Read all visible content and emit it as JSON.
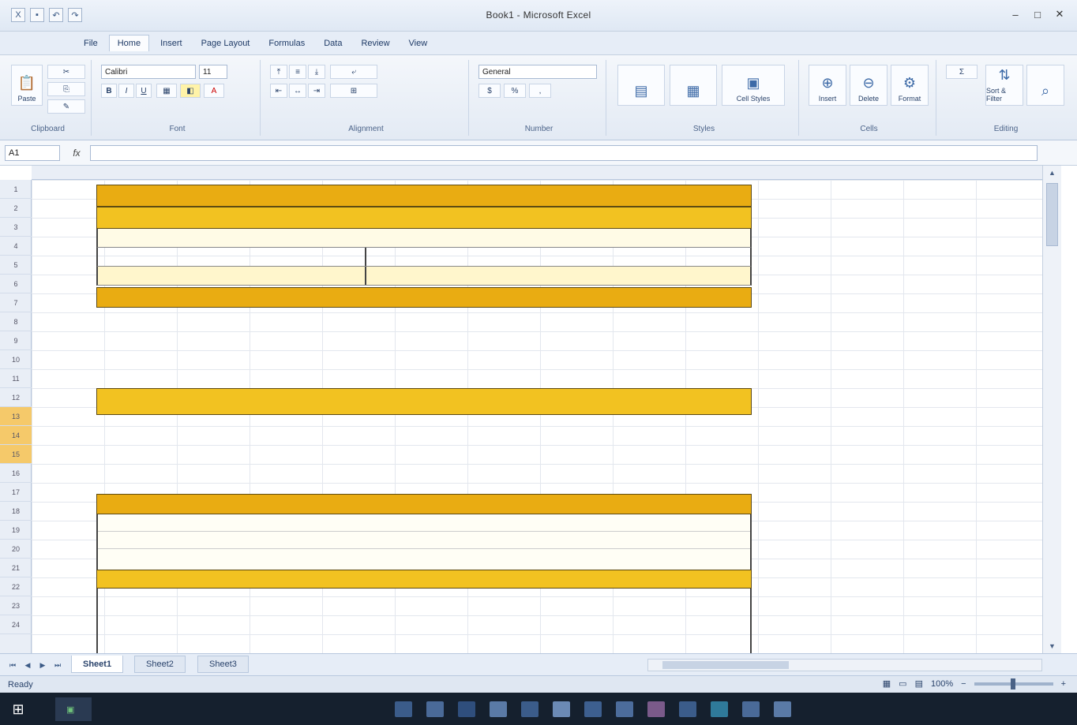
{
  "window": {
    "title": "Book1 - Microsoft Excel"
  },
  "menu": {
    "items": [
      "File",
      "Home",
      "Insert",
      "Page Layout",
      "Formulas",
      "Data",
      "Review",
      "View"
    ],
    "active_index": 1
  },
  "ribbon": {
    "groups": [
      "Clipboard",
      "Font",
      "Alignment",
      "Number",
      "Styles",
      "Cells",
      "Editing"
    ],
    "paste_label": "Paste",
    "font_name": "Calibri",
    "font_size": "11",
    "number_format": "General",
    "styles_label": "Cell Styles",
    "insert_label": "Insert",
    "delete_label": "Delete",
    "format_label": "Format",
    "sort_label": "Sort & Filter"
  },
  "formula_bar": {
    "name_box": "A1",
    "fx": "fx",
    "content": ""
  },
  "rows": {
    "numbers": [
      "1",
      "2",
      "3",
      "4",
      "5",
      "6",
      "7",
      "8",
      "9",
      "10",
      "11",
      "12",
      "13",
      "14",
      "15",
      "16",
      "17",
      "18",
      "19",
      "20",
      "21",
      "22",
      "23",
      "24"
    ],
    "selected": [
      "13",
      "14",
      "15"
    ]
  },
  "form": {
    "title": "",
    "subtitle": "",
    "row1_left": "",
    "row1_right": "",
    "row2_left": "",
    "row2_right": "",
    "section1": "",
    "para1": [
      "",
      "",
      ""
    ],
    "section2": "",
    "para2": [
      "",
      "",
      ""
    ],
    "section3": "",
    "list": [
      "",
      "",
      ""
    ],
    "section4": ""
  },
  "sheets": {
    "tabs": [
      "Sheet1",
      "Sheet2",
      "Sheet3"
    ],
    "active_index": 0
  },
  "status": {
    "ready": "Ready",
    "zoom": "100%"
  },
  "taskbar": {
    "app_label": "",
    "time": "",
    "date": ""
  },
  "colors": {
    "accent_dark": "#e9ac12",
    "accent_mid": "#f2c221",
    "ribbon_blue": "#dfe8f4"
  }
}
